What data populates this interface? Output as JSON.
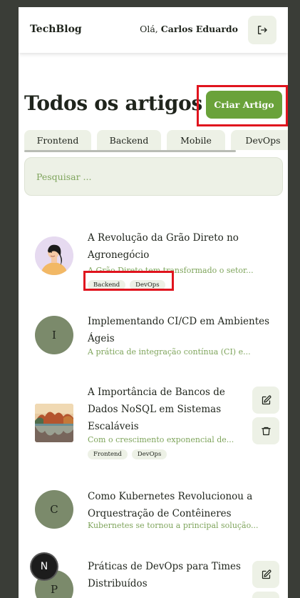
{
  "header": {
    "logo": "TechBlog",
    "greeting_prefix": "Olá,",
    "user_name": "Carlos Eduardo"
  },
  "main": {
    "title": "Todos os artigos",
    "create_label": "Criar Artigo"
  },
  "tabs": [
    {
      "label": "Frontend"
    },
    {
      "label": "Backend"
    },
    {
      "label": "Mobile"
    },
    {
      "label": "DevOps"
    }
  ],
  "search": {
    "placeholder": "Pesquisar ..."
  },
  "articles": [
    {
      "title": "A Revolução da Grão Direto no Agronegócio",
      "excerpt": "A Grão Direto tem transformado o setor...",
      "tags": [
        "Backend",
        "DevOps"
      ],
      "avatar": "illustration"
    },
    {
      "title": "Implementando CI/CD em Ambientes Ágeis",
      "excerpt": "A prática de integração contínua (CI) e...",
      "avatar_letter": "I"
    },
    {
      "title": "A Importância de Bancos de Dados NoSQL em Sistemas Escaláveis",
      "excerpt": "Com o crescimento exponencial de...",
      "tags": [
        "Frontend",
        "DevOps"
      ],
      "avatar": "landscape-photo"
    },
    {
      "title": "Como Kubernetes Revolucionou a Orquestração de Contêineres",
      "excerpt": "Kubernetes se tornou a principal solução...",
      "avatar_letter": "C"
    },
    {
      "title": "Práticas de DevOps para Times Distribuídos",
      "avatar_letter": "P"
    }
  ],
  "fab": {
    "letter": "N"
  },
  "colors": {
    "accent": "#6aa23a",
    "surface": "#edf1e6",
    "avatar_bg": "#7b8a6b",
    "highlight": "#e0141e",
    "backdrop": "#3a3d37"
  }
}
